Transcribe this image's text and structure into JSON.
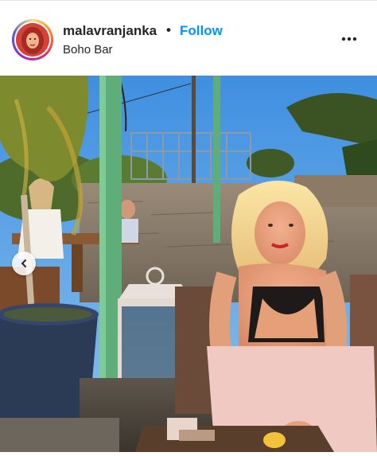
{
  "post": {
    "username": "malavranjanka",
    "separator": "•",
    "follow_label": "Follow",
    "location": "Boho Bar"
  },
  "icons": {
    "more": "more-options-icon",
    "prev": "chevron-left-icon"
  },
  "colors": {
    "follow": "#0095f6",
    "text": "#262626"
  }
}
